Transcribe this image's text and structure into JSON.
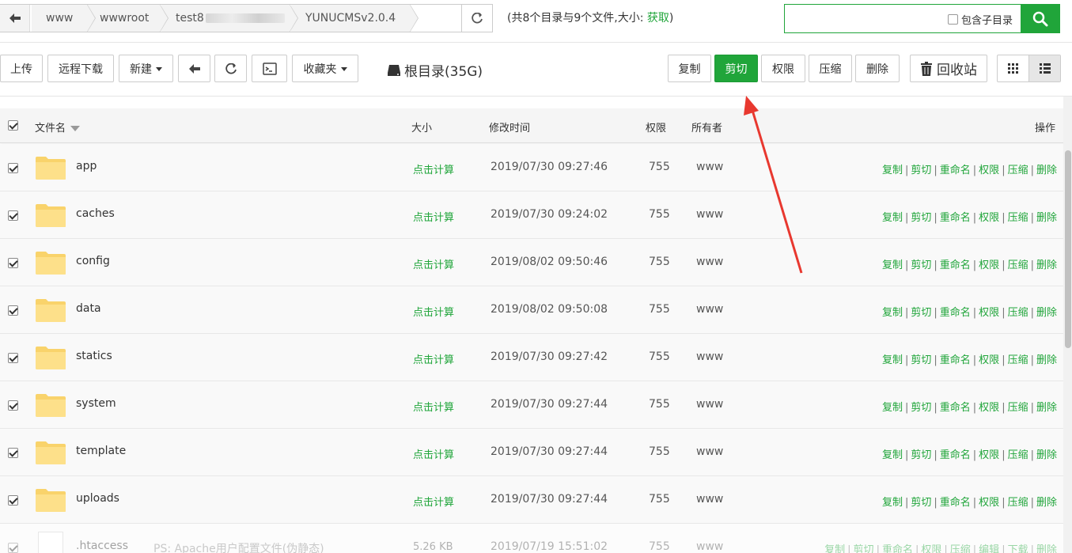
{
  "breadcrumb": {
    "items": [
      "www",
      "wwwroot",
      "test8",
      "YUNUCMSv2.0.4"
    ]
  },
  "summary": {
    "text": "(共8个目录与9个文件,大小: ",
    "link": "获取",
    "close": ")"
  },
  "search": {
    "placeholder": "",
    "subdir_label": "包含子目录"
  },
  "toolbar": {
    "upload": "上传",
    "remote_download": "远程下载",
    "new": "新建",
    "favorites": "收藏夹",
    "root": "根目录(35G)",
    "copy": "复制",
    "cut": "剪切",
    "permission": "权限",
    "compress": "压缩",
    "delete": "删除",
    "recycle": "回收站"
  },
  "table": {
    "headers": {
      "name": "文件名",
      "size": "大小",
      "mtime": "修改时间",
      "perm": "权限",
      "owner": "所有者",
      "ops": "操作"
    },
    "calc_label": "点击计算",
    "ops": [
      "复制",
      "剪切",
      "重命名",
      "权限",
      "压缩",
      "删除"
    ],
    "rows": [
      {
        "name": "app",
        "mtime": "2019/07/30 09:27:46",
        "perm": "755",
        "owner": "www"
      },
      {
        "name": "caches",
        "mtime": "2019/07/30 09:24:02",
        "perm": "755",
        "owner": "www"
      },
      {
        "name": "config",
        "mtime": "2019/08/02 09:50:46",
        "perm": "755",
        "owner": "www"
      },
      {
        "name": "data",
        "mtime": "2019/08/02 09:50:08",
        "perm": "755",
        "owner": "www"
      },
      {
        "name": "statics",
        "mtime": "2019/07/30 09:27:42",
        "perm": "755",
        "owner": "www"
      },
      {
        "name": "system",
        "mtime": "2019/07/30 09:27:44",
        "perm": "755",
        "owner": "www"
      },
      {
        "name": "template",
        "mtime": "2019/07/30 09:27:44",
        "perm": "755",
        "owner": "www"
      },
      {
        "name": "uploads",
        "mtime": "2019/07/30 09:27:44",
        "perm": "755",
        "owner": "www"
      }
    ],
    "file_row": {
      "name": ".htaccess",
      "desc": "PS: Apache用户配置文件(伪静态)",
      "size": "5.26 KB",
      "mtime": "2019/07/19 15:51:02",
      "perm": "755",
      "owner": "www",
      "ops": [
        "复制",
        "剪切",
        "重命名",
        "权限",
        "压缩",
        "编辑",
        "下载",
        "删除"
      ]
    }
  },
  "colors": {
    "accent": "#20a53a",
    "annotation_arrow": "#e8382f"
  },
  "icons": [
    "back-arrow-icon",
    "refresh-icon",
    "search-icon",
    "terminal-icon",
    "hdd-icon",
    "trash-icon",
    "grid-view-icon",
    "list-view-icon",
    "folder-icon"
  ]
}
